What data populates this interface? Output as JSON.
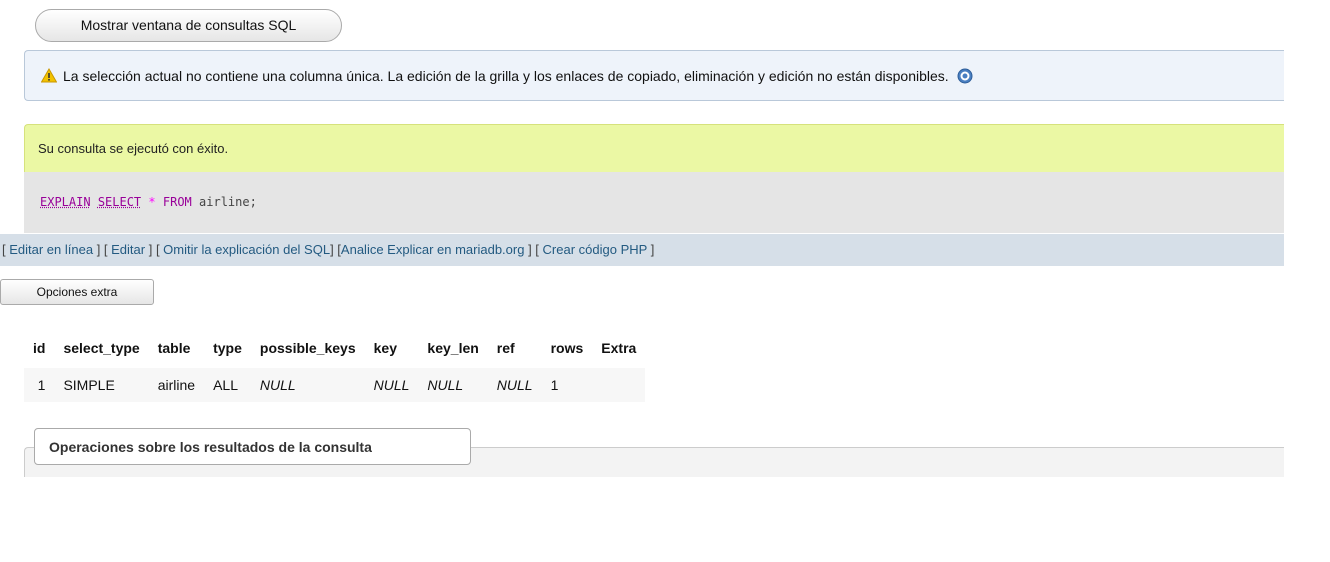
{
  "toolbar": {
    "show_sql_window": "Mostrar ventana de consultas SQL"
  },
  "notice": {
    "message": "La selección actual no contiene una columna única. La edición de la grilla y los enlaces de copiado, eliminación y edición no están disponibles.",
    "icon": "warning-icon",
    "help_icon": "help-icon"
  },
  "success": {
    "message": "Su consulta se ejecutó con éxito."
  },
  "sql": {
    "kw1": "EXPLAIN",
    "kw2": "SELECT",
    "star": "*",
    "kw3": "FROM",
    "rest": "airline;"
  },
  "links": {
    "inline_edit": "Editar en línea",
    "edit": "Editar",
    "skip_explain": "Omitir la explicación del SQL",
    "analyze": "Analice Explicar en mariadb.org",
    "create_php": "Crear código PHP"
  },
  "extra_options": "Opciones extra",
  "results": {
    "columns": [
      "id",
      "select_type",
      "table",
      "type",
      "possible_keys",
      "key",
      "key_len",
      "ref",
      "rows",
      "Extra"
    ],
    "rows": [
      {
        "id": "1",
        "select_type": "SIMPLE",
        "table": "airline",
        "type": "ALL",
        "possible_keys": "NULL",
        "key": "NULL",
        "key_len": "NULL",
        "ref": "NULL",
        "rows": "1",
        "Extra": ""
      }
    ]
  },
  "operations_legend": "Operaciones sobre los resultados de la consulta",
  "colors": {
    "success_bg": "#ebf8a4",
    "link": "#235a81",
    "notice_bg": "#eef3fa"
  }
}
